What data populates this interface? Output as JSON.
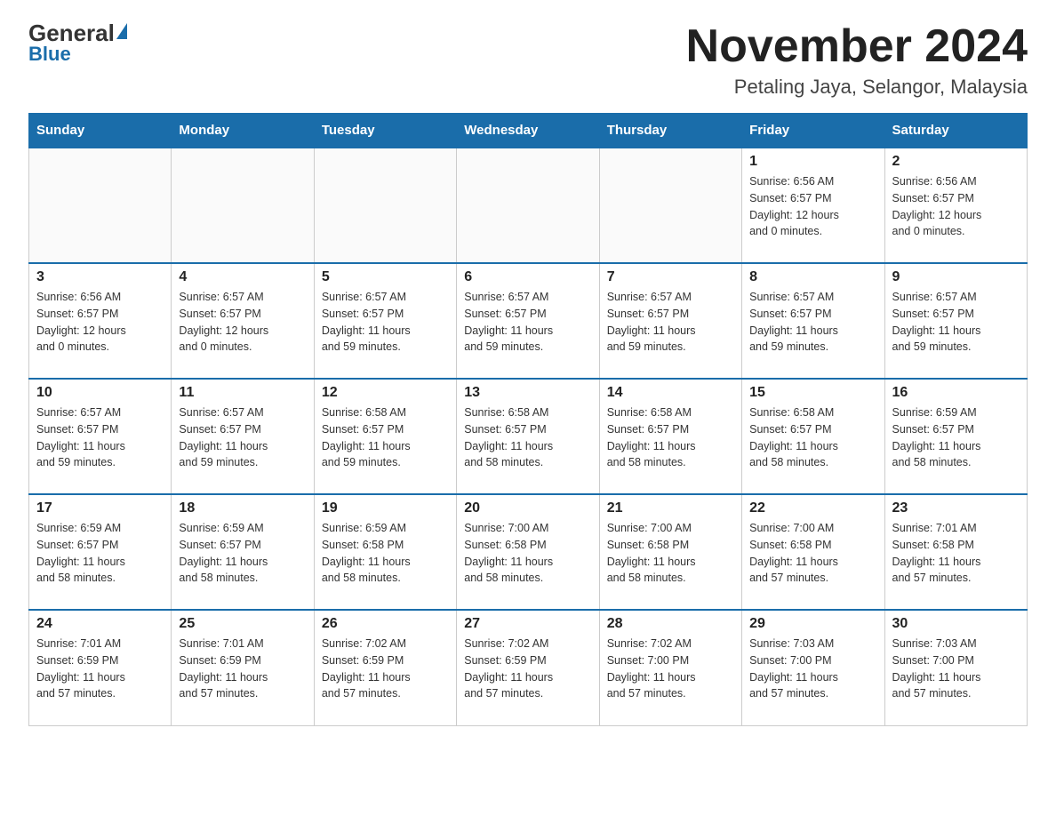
{
  "header": {
    "logo_general": "General",
    "logo_blue": "Blue",
    "month_title": "November 2024",
    "location": "Petaling Jaya, Selangor, Malaysia"
  },
  "days_of_week": [
    "Sunday",
    "Monday",
    "Tuesday",
    "Wednesday",
    "Thursday",
    "Friday",
    "Saturday"
  ],
  "weeks": [
    [
      {
        "day": "",
        "info": ""
      },
      {
        "day": "",
        "info": ""
      },
      {
        "day": "",
        "info": ""
      },
      {
        "day": "",
        "info": ""
      },
      {
        "day": "",
        "info": ""
      },
      {
        "day": "1",
        "info": "Sunrise: 6:56 AM\nSunset: 6:57 PM\nDaylight: 12 hours\nand 0 minutes."
      },
      {
        "day": "2",
        "info": "Sunrise: 6:56 AM\nSunset: 6:57 PM\nDaylight: 12 hours\nand 0 minutes."
      }
    ],
    [
      {
        "day": "3",
        "info": "Sunrise: 6:56 AM\nSunset: 6:57 PM\nDaylight: 12 hours\nand 0 minutes."
      },
      {
        "day": "4",
        "info": "Sunrise: 6:57 AM\nSunset: 6:57 PM\nDaylight: 12 hours\nand 0 minutes."
      },
      {
        "day": "5",
        "info": "Sunrise: 6:57 AM\nSunset: 6:57 PM\nDaylight: 11 hours\nand 59 minutes."
      },
      {
        "day": "6",
        "info": "Sunrise: 6:57 AM\nSunset: 6:57 PM\nDaylight: 11 hours\nand 59 minutes."
      },
      {
        "day": "7",
        "info": "Sunrise: 6:57 AM\nSunset: 6:57 PM\nDaylight: 11 hours\nand 59 minutes."
      },
      {
        "day": "8",
        "info": "Sunrise: 6:57 AM\nSunset: 6:57 PM\nDaylight: 11 hours\nand 59 minutes."
      },
      {
        "day": "9",
        "info": "Sunrise: 6:57 AM\nSunset: 6:57 PM\nDaylight: 11 hours\nand 59 minutes."
      }
    ],
    [
      {
        "day": "10",
        "info": "Sunrise: 6:57 AM\nSunset: 6:57 PM\nDaylight: 11 hours\nand 59 minutes."
      },
      {
        "day": "11",
        "info": "Sunrise: 6:57 AM\nSunset: 6:57 PM\nDaylight: 11 hours\nand 59 minutes."
      },
      {
        "day": "12",
        "info": "Sunrise: 6:58 AM\nSunset: 6:57 PM\nDaylight: 11 hours\nand 59 minutes."
      },
      {
        "day": "13",
        "info": "Sunrise: 6:58 AM\nSunset: 6:57 PM\nDaylight: 11 hours\nand 58 minutes."
      },
      {
        "day": "14",
        "info": "Sunrise: 6:58 AM\nSunset: 6:57 PM\nDaylight: 11 hours\nand 58 minutes."
      },
      {
        "day": "15",
        "info": "Sunrise: 6:58 AM\nSunset: 6:57 PM\nDaylight: 11 hours\nand 58 minutes."
      },
      {
        "day": "16",
        "info": "Sunrise: 6:59 AM\nSunset: 6:57 PM\nDaylight: 11 hours\nand 58 minutes."
      }
    ],
    [
      {
        "day": "17",
        "info": "Sunrise: 6:59 AM\nSunset: 6:57 PM\nDaylight: 11 hours\nand 58 minutes."
      },
      {
        "day": "18",
        "info": "Sunrise: 6:59 AM\nSunset: 6:57 PM\nDaylight: 11 hours\nand 58 minutes."
      },
      {
        "day": "19",
        "info": "Sunrise: 6:59 AM\nSunset: 6:58 PM\nDaylight: 11 hours\nand 58 minutes."
      },
      {
        "day": "20",
        "info": "Sunrise: 7:00 AM\nSunset: 6:58 PM\nDaylight: 11 hours\nand 58 minutes."
      },
      {
        "day": "21",
        "info": "Sunrise: 7:00 AM\nSunset: 6:58 PM\nDaylight: 11 hours\nand 58 minutes."
      },
      {
        "day": "22",
        "info": "Sunrise: 7:00 AM\nSunset: 6:58 PM\nDaylight: 11 hours\nand 57 minutes."
      },
      {
        "day": "23",
        "info": "Sunrise: 7:01 AM\nSunset: 6:58 PM\nDaylight: 11 hours\nand 57 minutes."
      }
    ],
    [
      {
        "day": "24",
        "info": "Sunrise: 7:01 AM\nSunset: 6:59 PM\nDaylight: 11 hours\nand 57 minutes."
      },
      {
        "day": "25",
        "info": "Sunrise: 7:01 AM\nSunset: 6:59 PM\nDaylight: 11 hours\nand 57 minutes."
      },
      {
        "day": "26",
        "info": "Sunrise: 7:02 AM\nSunset: 6:59 PM\nDaylight: 11 hours\nand 57 minutes."
      },
      {
        "day": "27",
        "info": "Sunrise: 7:02 AM\nSunset: 6:59 PM\nDaylight: 11 hours\nand 57 minutes."
      },
      {
        "day": "28",
        "info": "Sunrise: 7:02 AM\nSunset: 7:00 PM\nDaylight: 11 hours\nand 57 minutes."
      },
      {
        "day": "29",
        "info": "Sunrise: 7:03 AM\nSunset: 7:00 PM\nDaylight: 11 hours\nand 57 minutes."
      },
      {
        "day": "30",
        "info": "Sunrise: 7:03 AM\nSunset: 7:00 PM\nDaylight: 11 hours\nand 57 minutes."
      }
    ]
  ]
}
